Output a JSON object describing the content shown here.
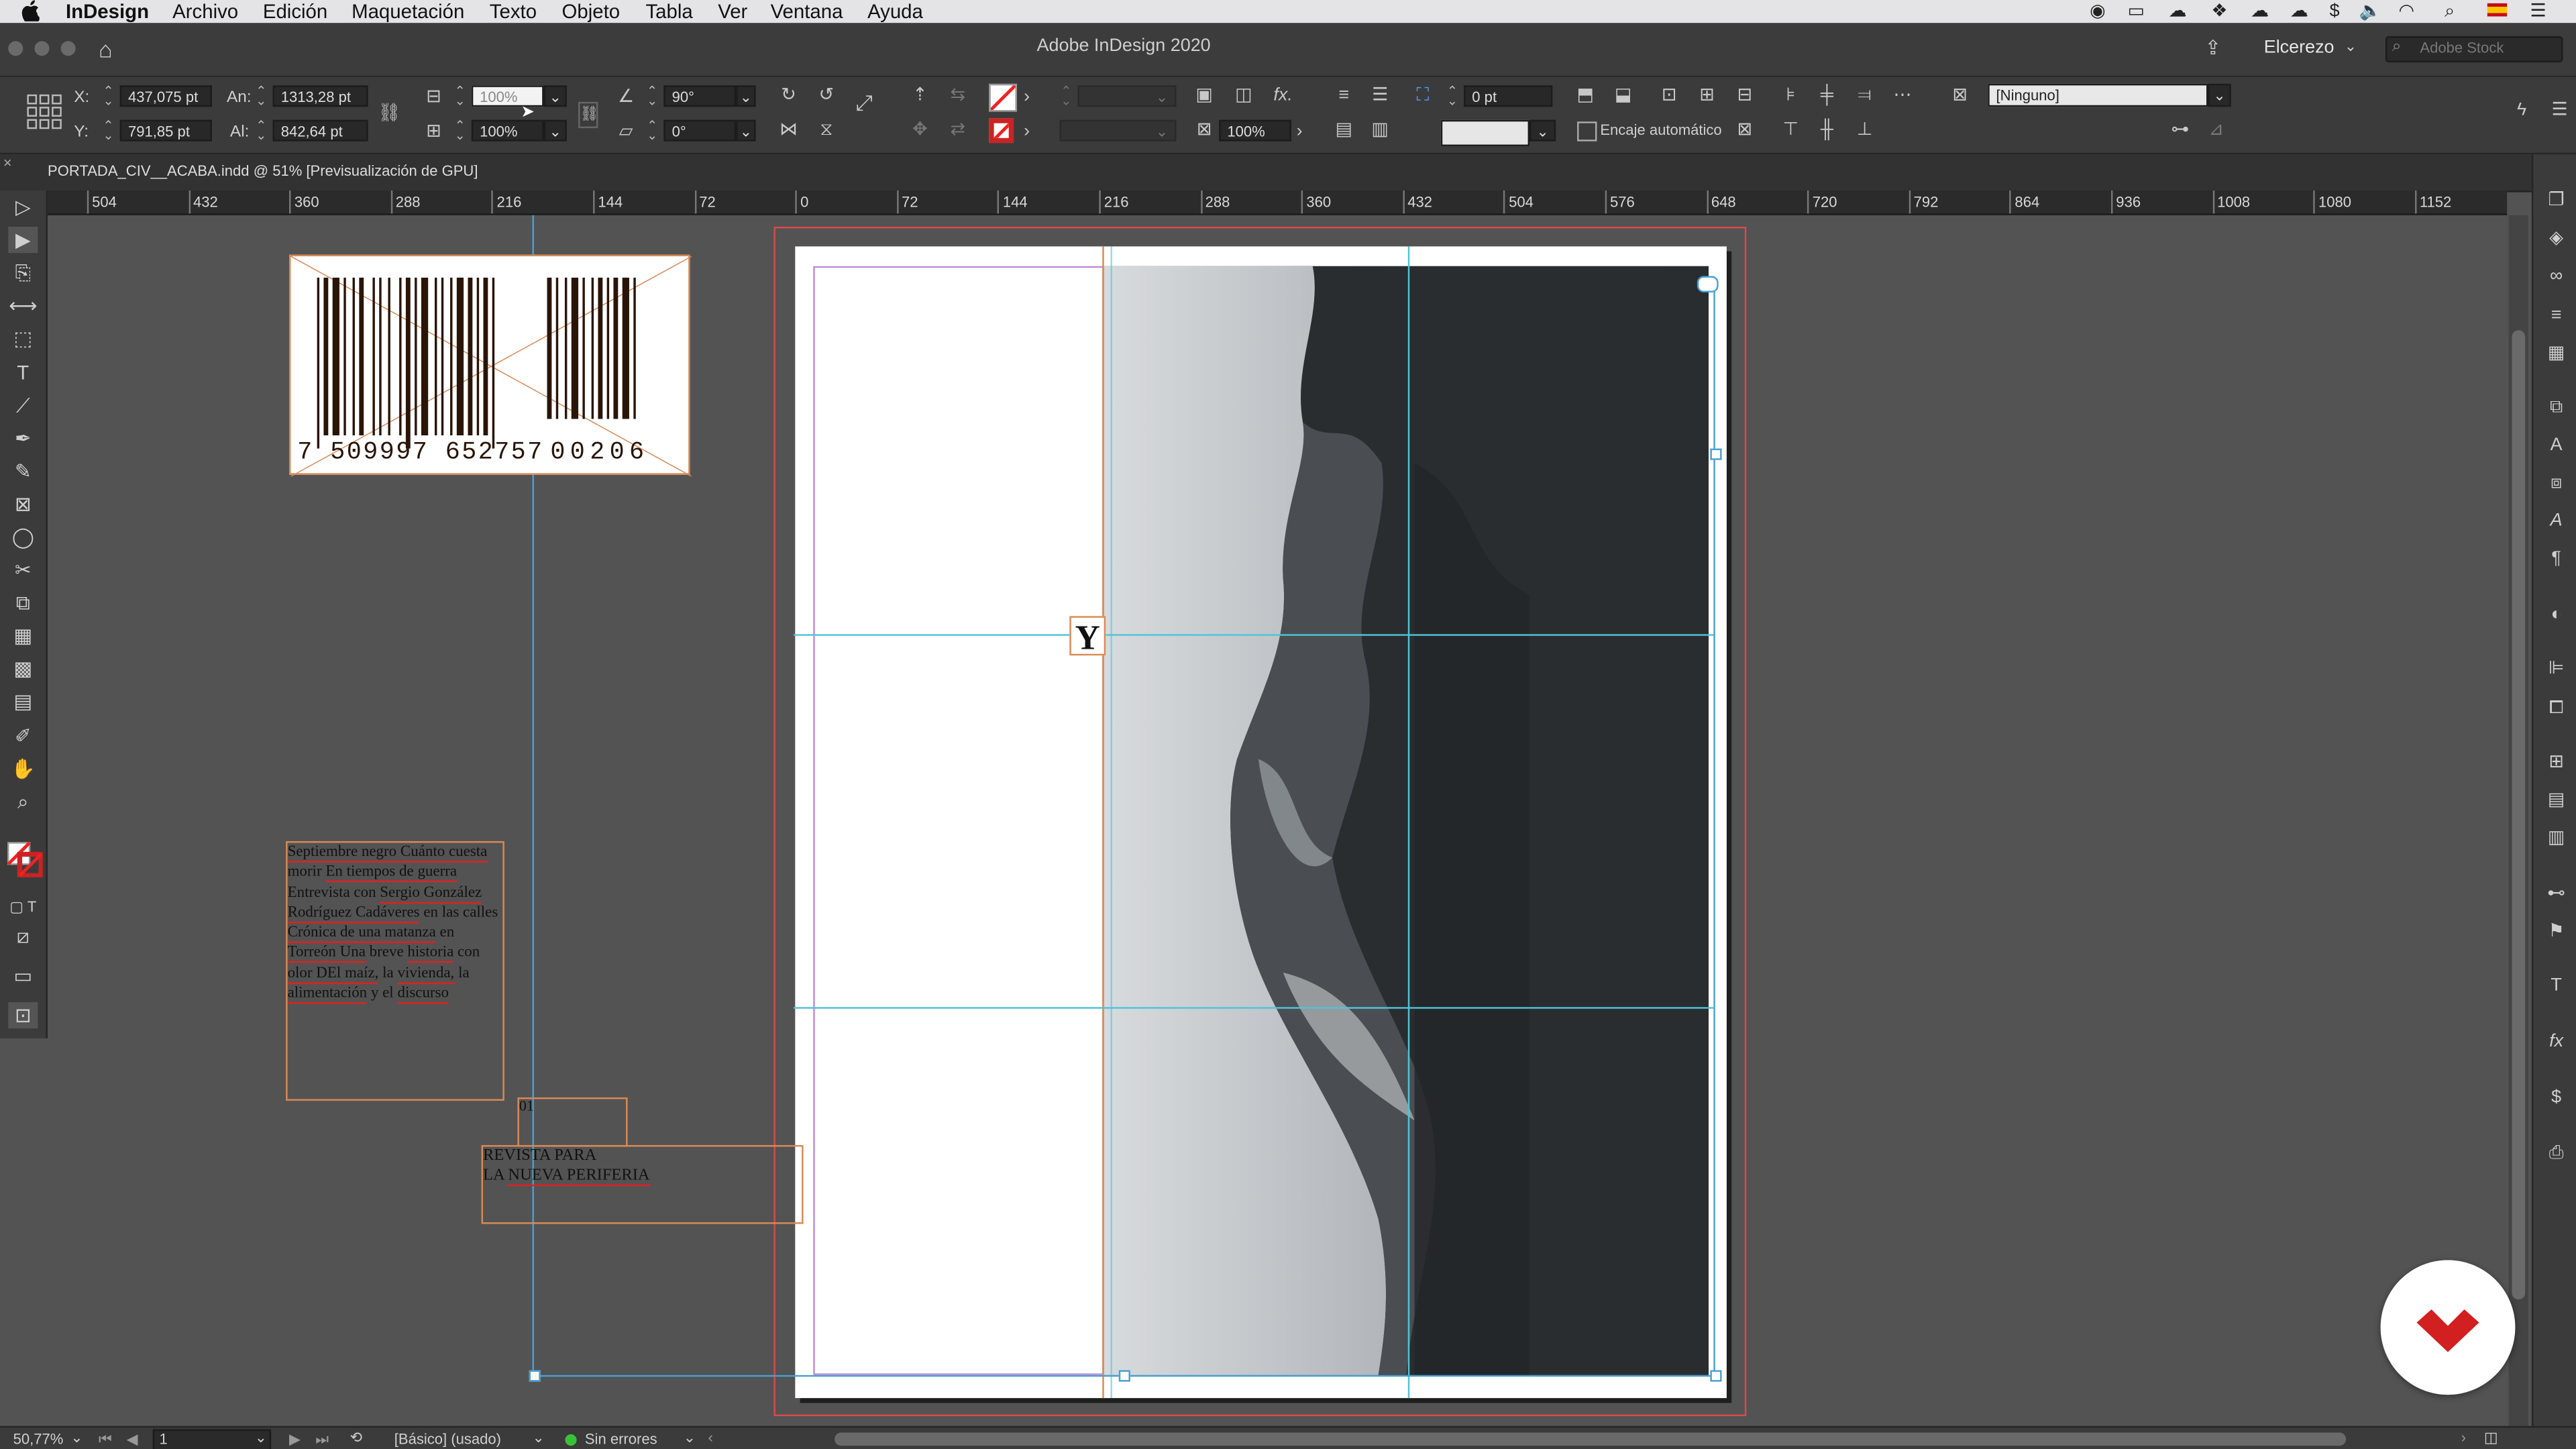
{
  "menubar": {
    "apple": "",
    "app": "InDesign",
    "items": [
      "Archivo",
      "Edición",
      "Maquetación",
      "Texto",
      "Objeto",
      "Tabla",
      "Ver",
      "Ventana",
      "Ayuda"
    ]
  },
  "window": {
    "title": "Adobe InDesign 2020",
    "workspace": "Elcerezo",
    "stock_search_placeholder": "Adobe Stock"
  },
  "control": {
    "x_label": "X:",
    "x_value": "437,075 pt",
    "y_label": "Y:",
    "y_value": "791,85 pt",
    "w_label": "An:",
    "w_value": "1313,28 pt",
    "h_label": "Al:",
    "h_value": "842,64 pt",
    "scale_x": "100%",
    "scale_y": "100%",
    "rotation": "90°",
    "shear": "0°",
    "stroke_weight": "0 pt",
    "opacity": "100%",
    "autofit_label": "Encaje automático",
    "object_style": "[Ninguno]"
  },
  "document": {
    "tab_title": "PORTADA_CIV__ACABA.indd @ 51% [Previsualización de GPU]"
  },
  "ruler": {
    "labels": [
      "504",
      "432",
      "360",
      "288",
      "216",
      "144",
      "72",
      "0",
      "72",
      "144",
      "216",
      "288",
      "360",
      "432",
      "504",
      "576",
      "648",
      "720",
      "792",
      "864",
      "936",
      "1008",
      "1080",
      "1152"
    ]
  },
  "canvas": {
    "barcode_main": "7 509997 652757",
    "barcode_addon": "00206",
    "text_block": [
      {
        "t": "Septiembre negro ",
        "u": true
      },
      {
        "t": "Cuánto cuesta",
        "u": true
      },
      {
        "t": " morir ",
        "u": false
      },
      {
        "t": "En tiempos de guerra",
        "u": true
      },
      {
        "t": " Entrevista con ",
        "u": false
      },
      {
        "t": "Sergio González Rodríguez Cadáveres",
        "u": true
      },
      {
        "t": " en las calles ",
        "u": false
      },
      {
        "t": "Crónica de una matanza",
        "u": true
      },
      {
        "t": " en ",
        "u": false
      },
      {
        "t": "Torreón Una",
        "u": true
      },
      {
        "t": " breve ",
        "u": false
      },
      {
        "t": "historia",
        "u": true
      },
      {
        "t": " con ",
        "u": false
      },
      {
        "t": "olor DEl maíz,",
        "u": true
      },
      {
        "t": " la ",
        "u": false
      },
      {
        "t": "vivienda,",
        "u": true
      },
      {
        "t": " la ",
        "u": false
      },
      {
        "t": "alimentación",
        "u": true
      },
      {
        "t": " y el ",
        "u": false
      },
      {
        "t": "discurso",
        "u": true
      }
    ],
    "issue_number": "01",
    "tagline_line1": "REVISTA PARA",
    "tagline_line2_a": "LA ",
    "tagline_line2_b": "NUEVA PERIFERIA",
    "spine_letter": "Y"
  },
  "status": {
    "zoom": "50,77%",
    "page": "1",
    "profile": "[Básico] (usado)",
    "preflight": "Sin errores"
  },
  "colors": {
    "accent_logo": "#d21f1f",
    "guide_cyan": "#4fc4d8",
    "frame_orange": "#d98a55",
    "margin_magenta": "#c08ad8",
    "bleed_red": "#d94a4a"
  }
}
